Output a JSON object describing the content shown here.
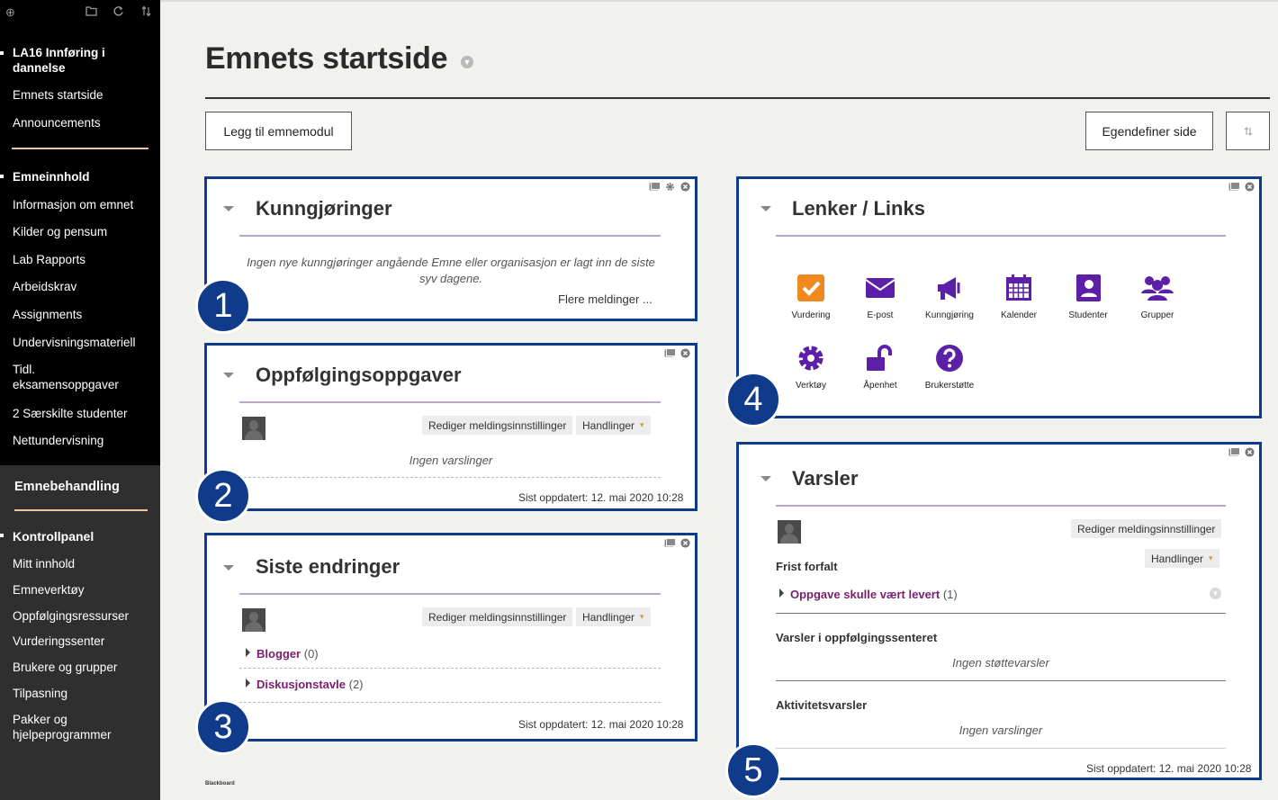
{
  "sidebar": {
    "tool_icons": [
      "plus-circle-icon",
      "folder-icon",
      "refresh-icon",
      "sort-icon"
    ],
    "course_title": "LA16 Innføring i dannelse",
    "top_items": [
      "Emnets startside",
      "Announcements"
    ],
    "content_heading": "Emneinnhold",
    "content_items": [
      "Informasjon om emnet",
      "Kilder og pensum",
      "Lab Rapports",
      "Arbeidskrav",
      "Assignments",
      "Undervisningsmateriell",
      "Tidl. eksamensoppgaver",
      "2 Særskilte studenter",
      "Nettundervisning"
    ],
    "management_heading": "Emnebehandling",
    "control_panel": "Kontrollpanel",
    "management_items": [
      "Mitt innhold",
      "Emneverktøy",
      "Oppfølgingsressurser",
      "Vurderingssenter",
      "Brukere og grupper",
      "Tilpasning",
      "Pakker og hjelpeprogrammer"
    ]
  },
  "page": {
    "title": "Emnets startside",
    "add_module": "Legg til emnemodul",
    "customize": "Egendefiner side",
    "footer": "Blackboard"
  },
  "modules": {
    "announcements": {
      "title": "Kunngjøringer",
      "empty": "Ingen nye kunngjøringer angående Emne eller organisasjon er lagt inn de siste syv dagene.",
      "more": "Flere meldinger ..."
    },
    "followup": {
      "title": "Oppfølgingsoppgaver",
      "edit": "Rediger meldingsinnstillinger",
      "actions": "Handlinger",
      "empty": "Ingen varslinger",
      "updated": "Sist oppdatert: 12. mai 2020 10:28"
    },
    "changes": {
      "title": "Siste endringer",
      "edit": "Rediger meldingsinnstillinger",
      "actions": "Handlinger",
      "items": [
        {
          "label": "Blogger",
          "count": "(0)"
        },
        {
          "label": "Diskusjonstavle",
          "count": "(2)"
        }
      ],
      "updated": "Sist oppdatert: 12. mai 2020 10:28"
    },
    "links": {
      "title": "Lenker / Links",
      "tiles": [
        {
          "label": "Vurdering",
          "icon": "checkbox-icon",
          "color": "#f08a1f"
        },
        {
          "label": "E-post",
          "icon": "envelope-icon",
          "color": "#5b1fa8"
        },
        {
          "label": "Kunngjøring",
          "icon": "megaphone-icon",
          "color": "#5b1fa8"
        },
        {
          "label": "Kalender",
          "icon": "calendar-icon",
          "color": "#5b1fa8"
        },
        {
          "label": "Studenter",
          "icon": "contacts-icon",
          "color": "#5b1fa8"
        },
        {
          "label": "Grupper",
          "icon": "group-icon",
          "color": "#5b1fa8"
        },
        {
          "label": "Verktøy",
          "icon": "gear-icon",
          "color": "#5b1fa8"
        },
        {
          "label": "Åpenhet",
          "icon": "unlock-icon",
          "color": "#5b1fa8"
        },
        {
          "label": "Brukerstøtte",
          "icon": "help-icon",
          "color": "#5b1fa8"
        }
      ]
    },
    "alerts": {
      "title": "Varsler",
      "edit": "Rediger meldingsinnstillinger",
      "actions": "Handlinger",
      "due_heading": "Frist forfalt",
      "due_item": "Oppgave skulle vært levert",
      "due_count": "(1)",
      "center_heading": "Varsler i oppfølgingssenteret",
      "center_empty": "Ingen støttevarsler",
      "activity_heading": "Aktivitetsvarsler",
      "activity_empty": "Ingen varslinger",
      "updated": "Sist oppdatert: 12. mai 2020 10:28"
    }
  },
  "badges": [
    "1",
    "2",
    "3",
    "4",
    "5"
  ],
  "colors": {
    "module_border": "#0f3b8a",
    "link": "#7a1e6e",
    "accent_orange": "#f08a1f",
    "accent_purple": "#5b1fa8"
  }
}
